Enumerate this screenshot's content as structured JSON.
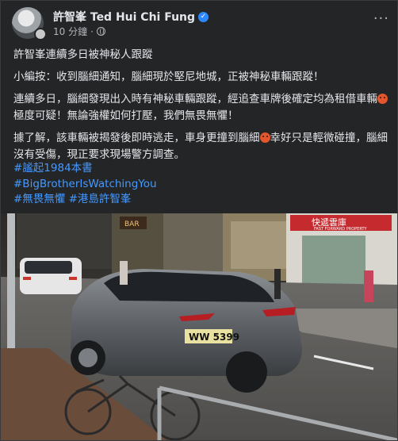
{
  "post": {
    "author": "許智峯 Ted Hui Chi Fung",
    "time": "10 分鐘",
    "separator": "·",
    "more_label": "···",
    "paragraphs": {
      "p1": "許智峯連續多日被神秘人跟蹤",
      "p2": "小編按：收到腦細通知，腦細現於堅尼地城，正被神秘車輛跟蹤！",
      "p3a": "連續多日，腦細發現出入時有神秘車輛跟蹤，經追查車牌後確定均為租借車輛",
      "p3b": "極度可疑！無論強權如何打壓，我們無畏無懼！",
      "p4a": "據了解，該車輛被揭發後即時逃走，車身更撞到腦細",
      "p4b": "幸好只是輕微碰撞，腦細沒有受傷，現正要求現場警方調查。"
    },
    "hashtags": [
      "#謐起1984本書",
      "#BigBrotherIsWatchingYou",
      "#無畏無懼",
      "#港島許智峯"
    ]
  },
  "photo": {
    "shop_sign": "快遞雲庫",
    "shop_sign_sub": "FAST FORWARD PROPERTY",
    "left_sign": "BAR",
    "plate": "WW 5399"
  },
  "icons": {
    "verified": "verified-badge-icon",
    "privacy": "globe-icon",
    "angry": "angry-face-emoji"
  }
}
